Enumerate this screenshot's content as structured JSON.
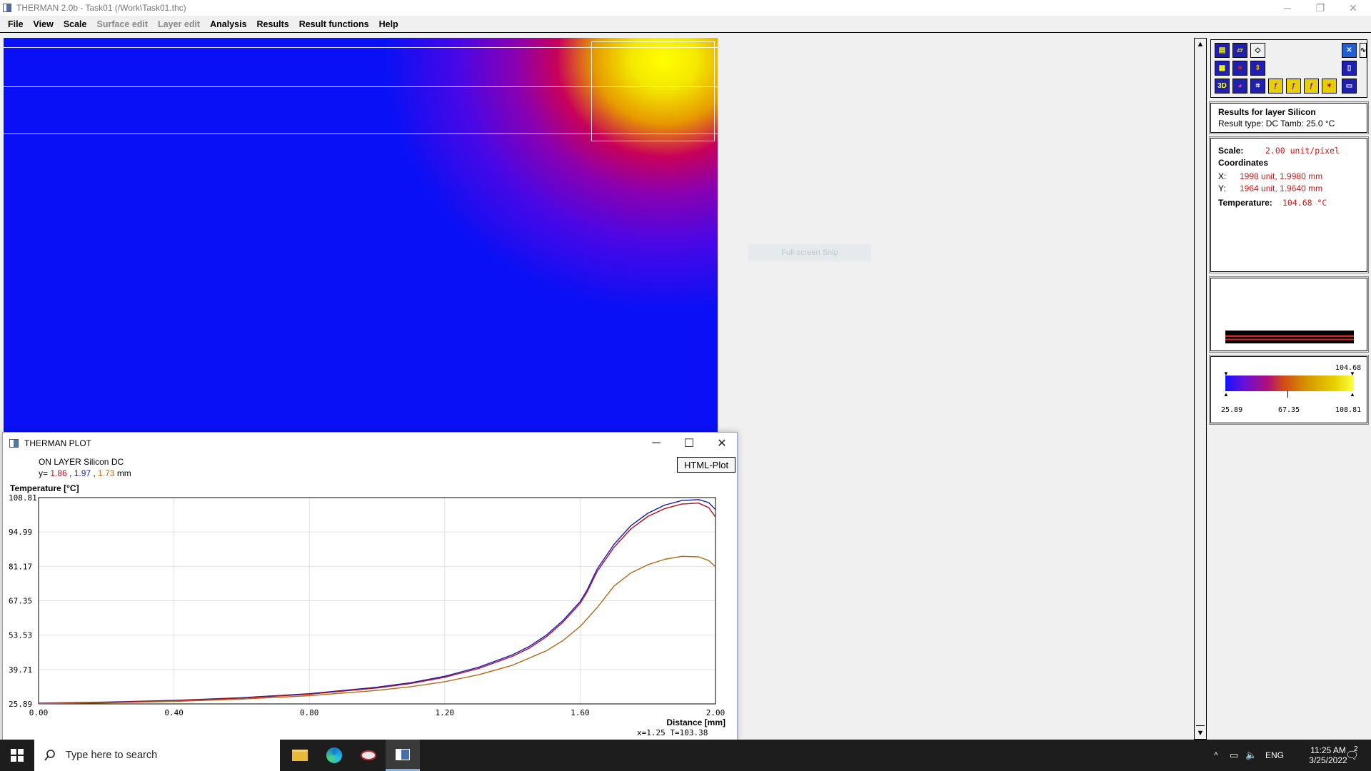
{
  "window": {
    "title": "THERMAN 2.0b - Task01 (/Work\\Task01.thc)",
    "minimize": "─",
    "restore": "❐",
    "close": "✕"
  },
  "menu": [
    {
      "label": "File",
      "enabled": true
    },
    {
      "label": "View",
      "enabled": true
    },
    {
      "label": "Scale",
      "enabled": true
    },
    {
      "label": "Surface edit",
      "enabled": false
    },
    {
      "label": "Layer edit",
      "enabled": false
    },
    {
      "label": "Analysis",
      "enabled": true
    },
    {
      "label": "Results",
      "enabled": true
    },
    {
      "label": "Result functions",
      "enabled": true
    },
    {
      "label": "Help",
      "enabled": true
    }
  ],
  "snip_label": "Full-screen Snip",
  "result_info": {
    "heading": "Results for layer Silicon",
    "result_type_line": "Result type:  DC   Tamb: 25.0 °C"
  },
  "coords": {
    "scale_label": "Scale:",
    "scale_value": "2.00 unit/pixel",
    "coordinates_label": "Coordinates",
    "x_label": "X:",
    "x_value": "1998 unit, 1.9980 mm",
    "y_label": "Y:",
    "y_value": "1964 unit, 1.9640 mm",
    "temp_label": "Temperature:",
    "temp_value": "104.68  °C"
  },
  "colorbar": {
    "top_value": "104.68",
    "min": "25.89",
    "mid": "67.35",
    "max": "108.81"
  },
  "plot_window": {
    "title": "THERMAN PLOT",
    "minimize": "─",
    "maximize": "☐",
    "close": "✕",
    "layer_line": "ON LAYER Silicon   DC",
    "y_prefix": "y=",
    "y_values": [
      "1.86",
      "1.97",
      "1.73"
    ],
    "y_unit": "mm",
    "html_plot_button": "HTML-Plot",
    "cursor_readout": "x=1.25    T=103.38"
  },
  "chart_data": {
    "type": "line",
    "title": "",
    "ylabel": "Temperature [°C]",
    "xlabel": "Distance [mm]",
    "xlim": [
      0,
      2.0
    ],
    "ylim": [
      25.89,
      108.81
    ],
    "xticks": [
      "0.00",
      "0.40",
      "0.80",
      "1.20",
      "1.60",
      "2.00"
    ],
    "yticks": [
      "25.89",
      "39.71",
      "53.53",
      "67.35",
      "81.17",
      "94.99",
      "108.81"
    ],
    "grid": true,
    "series": [
      {
        "color": "#1a1ab4",
        "x": [
          0.0,
          0.2,
          0.4,
          0.6,
          0.8,
          1.0,
          1.1,
          1.2,
          1.3,
          1.4,
          1.45,
          1.5,
          1.55,
          1.6,
          1.62,
          1.65,
          1.7,
          1.75,
          1.8,
          1.85,
          1.9,
          1.95,
          1.98,
          2.0
        ],
        "y": [
          26.2,
          26.6,
          27.3,
          28.4,
          30.0,
          32.6,
          34.4,
          37.0,
          40.6,
          45.6,
          49.0,
          53.5,
          59.5,
          67.0,
          71.5,
          80.0,
          90.0,
          97.5,
          102.5,
          105.8,
          107.6,
          108.0,
          106.8,
          104.0
        ]
      },
      {
        "color": "#b01020",
        "x": [
          0.0,
          0.2,
          0.4,
          0.6,
          0.8,
          1.0,
          1.1,
          1.2,
          1.3,
          1.4,
          1.45,
          1.5,
          1.55,
          1.6,
          1.62,
          1.65,
          1.7,
          1.75,
          1.8,
          1.85,
          1.9,
          1.95,
          1.98,
          2.0
        ],
        "y": [
          26.1,
          26.5,
          27.2,
          28.2,
          29.8,
          32.3,
          34.1,
          36.6,
          40.1,
          45.0,
          48.3,
          52.8,
          58.8,
          66.3,
          70.7,
          79.0,
          88.8,
          96.2,
          101.2,
          104.4,
          106.2,
          106.6,
          104.8,
          101.0
        ]
      },
      {
        "color": "#b06a18",
        "x": [
          0.0,
          0.2,
          0.4,
          0.6,
          0.8,
          1.0,
          1.1,
          1.2,
          1.3,
          1.4,
          1.5,
          1.55,
          1.6,
          1.65,
          1.7,
          1.75,
          1.8,
          1.85,
          1.9,
          1.95,
          1.98,
          2.0
        ],
        "y": [
          26.0,
          26.3,
          26.9,
          27.8,
          29.2,
          31.3,
          32.8,
          34.8,
          37.6,
          41.4,
          47.2,
          51.4,
          57.0,
          64.5,
          73.2,
          78.5,
          81.8,
          84.0,
          85.2,
          85.0,
          83.5,
          81.0
        ]
      }
    ]
  },
  "taskbar": {
    "search_placeholder": "Type here to search",
    "language": "ENG",
    "time": "11:25 AM",
    "date": "3/25/2022",
    "notification_count": "2"
  }
}
